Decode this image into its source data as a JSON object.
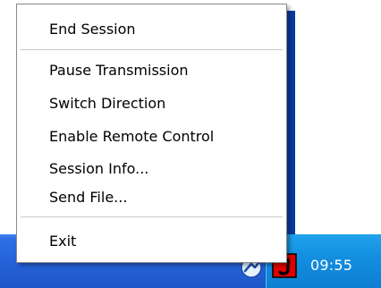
{
  "menu": {
    "items": [
      {
        "label": "End Session"
      },
      {
        "label": "Pause Transmission"
      },
      {
        "label": "Switch Direction"
      },
      {
        "label": "Enable Remote Control"
      },
      {
        "label": "Session Info..."
      },
      {
        "label": "Send File..."
      },
      {
        "label": "Exit"
      }
    ]
  },
  "taskbar": {
    "clock": "09:55",
    "tray_icons": [
      "network-monitor-icon",
      "remote-session-app-icon"
    ]
  },
  "colors": {
    "taskbar_blue": "#2563d9",
    "tray_blue": "#138fe0",
    "app_icon_red": "#e00000",
    "menu_bg": "#ffffff"
  }
}
